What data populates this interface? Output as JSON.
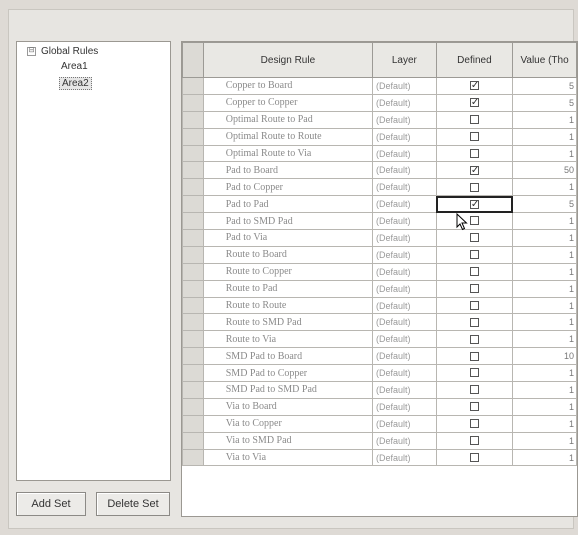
{
  "tree": {
    "expander": "⊟",
    "root": "Global Rules",
    "children": [
      "Area1",
      "Area2"
    ],
    "selected": "Area2"
  },
  "buttons": {
    "add": "Add Set",
    "delete": "Delete Set"
  },
  "grid": {
    "columns": [
      "Design Rule",
      "Layer",
      "Defined",
      "Value (Tho"
    ],
    "rows": [
      {
        "rule": "Copper to Board",
        "layer": "(Default)",
        "defined": true,
        "value": "5"
      },
      {
        "rule": "Copper to Copper",
        "layer": "(Default)",
        "defined": true,
        "value": "5"
      },
      {
        "rule": "Optimal Route to Pad",
        "layer": "(Default)",
        "defined": false,
        "value": "1"
      },
      {
        "rule": "Optimal Route to Route",
        "layer": "(Default)",
        "defined": false,
        "value": "1"
      },
      {
        "rule": "Optimal Route to Via",
        "layer": "(Default)",
        "defined": false,
        "value": "1"
      },
      {
        "rule": "Pad to Board",
        "layer": "(Default)",
        "defined": true,
        "value": "50"
      },
      {
        "rule": "Pad to Copper",
        "layer": "(Default)",
        "defined": false,
        "value": "1"
      },
      {
        "rule": "Pad to Pad",
        "layer": "(Default)",
        "defined": true,
        "value": "5"
      },
      {
        "rule": "Pad to SMD Pad",
        "layer": "(Default)",
        "defined": false,
        "value": "1"
      },
      {
        "rule": "Pad to Via",
        "layer": "(Default)",
        "defined": false,
        "value": "1"
      },
      {
        "rule": "Route to Board",
        "layer": "(Default)",
        "defined": false,
        "value": "1"
      },
      {
        "rule": "Route to Copper",
        "layer": "(Default)",
        "defined": false,
        "value": "1"
      },
      {
        "rule": "Route to Pad",
        "layer": "(Default)",
        "defined": false,
        "value": "1"
      },
      {
        "rule": "Route to Route",
        "layer": "(Default)",
        "defined": false,
        "value": "1"
      },
      {
        "rule": "Route to SMD Pad",
        "layer": "(Default)",
        "defined": false,
        "value": "1"
      },
      {
        "rule": "Route to Via",
        "layer": "(Default)",
        "defined": false,
        "value": "1"
      },
      {
        "rule": "SMD Pad to Board",
        "layer": "(Default)",
        "defined": false,
        "value": "10"
      },
      {
        "rule": "SMD Pad to Copper",
        "layer": "(Default)",
        "defined": false,
        "value": "1"
      },
      {
        "rule": "SMD Pad to SMD Pad",
        "layer": "(Default)",
        "defined": false,
        "value": "1"
      },
      {
        "rule": "Via to Board",
        "layer": "(Default)",
        "defined": false,
        "value": "1"
      },
      {
        "rule": "Via to Copper",
        "layer": "(Default)",
        "defined": false,
        "value": "1"
      },
      {
        "rule": "Via to SMD Pad",
        "layer": "(Default)",
        "defined": false,
        "value": "1"
      },
      {
        "rule": "Via to Via",
        "layer": "(Default)",
        "defined": false,
        "value": "1"
      }
    ],
    "focused_row": 7
  },
  "icons": {
    "cursor": "mouse-pointer-icon",
    "check": "✓"
  }
}
